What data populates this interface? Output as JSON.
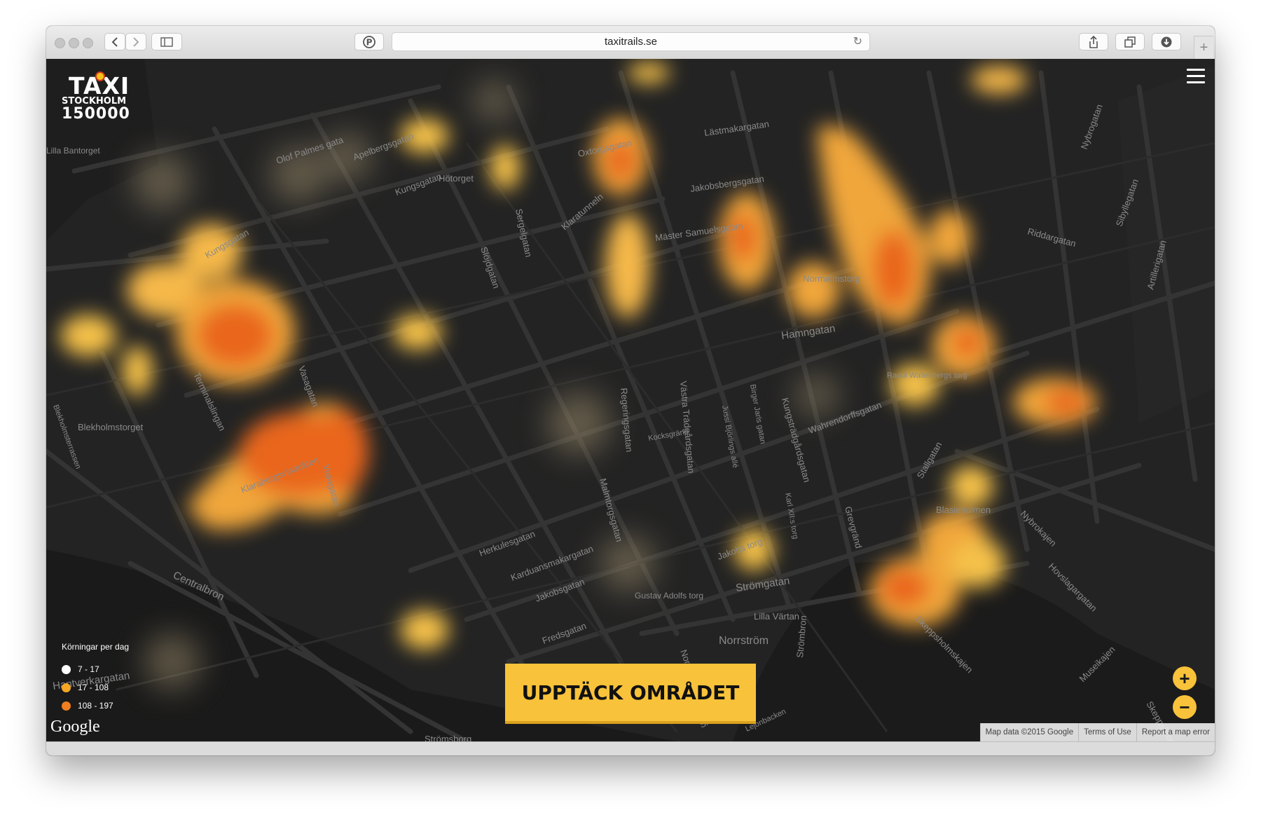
{
  "browser": {
    "url": "taxitrails.se"
  },
  "logo": {
    "line1": "TAXI",
    "line2": "STOCKHOLM",
    "line3": "150000"
  },
  "map": {
    "street_labels": [
      "Olof Palmes gata",
      "Apelbergsgatan",
      "Kungsgatan",
      "Hötorget",
      "Oxtorgsgatan",
      "Lästmakargatan",
      "Jakobsbergsgatan",
      "Klaratunneln",
      "Mäster Samuelsgatan",
      "Sergelgatan",
      "Slöjdgatan",
      "Normalmstorg",
      "Hamngatan",
      "Riddargatan",
      "Nybrogatan",
      "Sibyllegatan",
      "Artillerigatan",
      "Kungsgatan",
      "Vasagatan",
      "Terminalslingan",
      "Blekholmstorget",
      "Blekholmsterrassen",
      "Klarabergsviadukten",
      "Regeringsgatan",
      "Västra Trädgårdsgatan",
      "Jussi Björlings allé",
      "Birger Jarls gatan",
      "Kungsträdgårdsgatan",
      "Wahrendorffsgatan",
      "Kocksgränd",
      "Raoul Wallenbergs torg",
      "Stallgatan",
      "Blasieholmen",
      "Nybrokajen",
      "Hovslagargatan",
      "Herkulesgatan",
      "Karduansmakargatan",
      "Jakobsgatan",
      "Malmtorgsgatan",
      "Jakobs torg",
      "Karl XII:s torg",
      "Gustav Adolfs torg",
      "Strömgatan",
      "Lilla Värtan",
      "Norrström",
      "Strömbron",
      "Fredsgatan",
      "Centralbron",
      "Hantverkargatan",
      "Strömsborg",
      "Slottskajen",
      "Lejonbacken",
      "Skeppsholmskajen",
      "Museikajen",
      "Grevgränd",
      "Lilla Bantorget",
      "Vasagatan",
      "Norrbro",
      "Skeppsbron"
    ],
    "heat_points": [
      {
        "lng": 18.054,
        "lat": 59.334,
        "weight": 197
      },
      {
        "lng": 18.058,
        "lat": 59.331,
        "weight": 197
      },
      {
        "lng": 18.075,
        "lat": 59.335,
        "weight": 150
      },
      {
        "lng": 18.08,
        "lat": 59.332,
        "weight": 150
      },
      {
        "lng": 18.07,
        "lat": 59.3365,
        "weight": 140
      },
      {
        "lng": 18.066,
        "lat": 59.333,
        "weight": 60
      },
      {
        "lng": 18.078,
        "lat": 59.3295,
        "weight": 120
      }
    ]
  },
  "legend": {
    "title": "Körningar per dag",
    "items": [
      {
        "label": "7 - 17",
        "color": "#ffffff"
      },
      {
        "label": "17 - 108",
        "color": "#f5a623"
      },
      {
        "label": "108 - 197",
        "color": "#f07f1f"
      }
    ]
  },
  "cta": {
    "label": "UPPTÄCK OMRÅDET"
  },
  "controls": {
    "zoom_in": "+",
    "zoom_out": "−"
  },
  "attribution": {
    "google": "Google",
    "map_data": "Map data ©2015 Google",
    "terms": "Terms of Use",
    "report": "Report a map error"
  },
  "colors": {
    "accent": "#f8c23a",
    "heat_low": "#f5c14a",
    "heat_high": "#e9661f"
  }
}
